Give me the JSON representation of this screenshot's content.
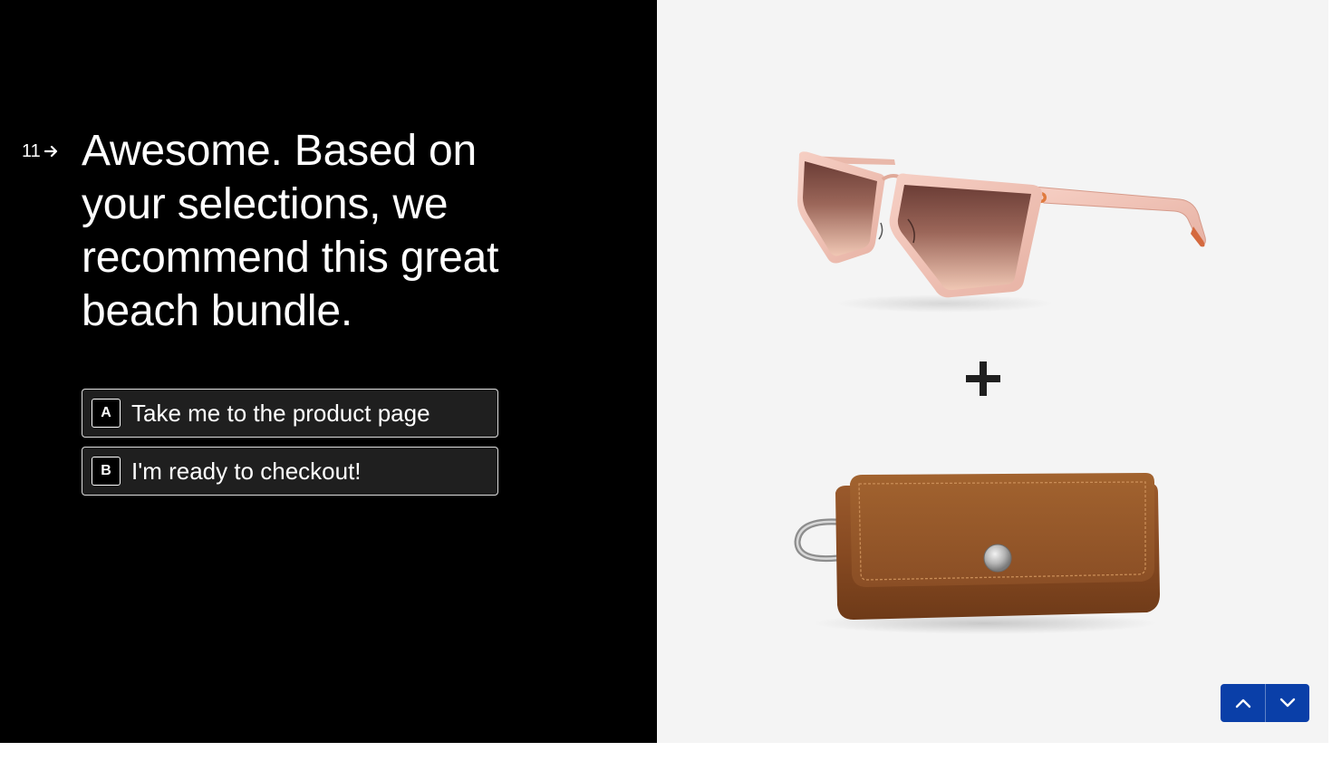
{
  "question": {
    "number": "11",
    "title": "Awesome. Based on your selections, we recommend this great beach bundle."
  },
  "choices": [
    {
      "key": "A",
      "label": "Take me to the product page"
    },
    {
      "key": "B",
      "label": "I'm ready to checkout!"
    }
  ],
  "products": [
    {
      "name": "sunglasses-image"
    },
    {
      "name": "plus-icon"
    },
    {
      "name": "leather-case-image"
    }
  ],
  "navigation": {
    "up_icon": "chevron-up-icon",
    "down_icon": "chevron-down-icon",
    "button_color": "#0a3fa8"
  },
  "colors": {
    "left_background": "#000000",
    "right_background": "#f4f4f4",
    "text": "#ffffff"
  }
}
